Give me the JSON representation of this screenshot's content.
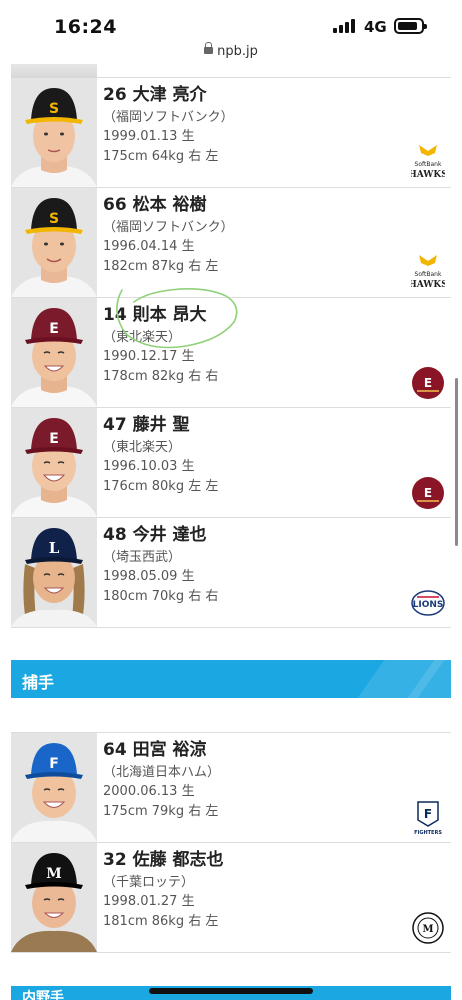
{
  "status": {
    "time": "16:24",
    "network": "4G"
  },
  "browser": {
    "url": "npb.jp"
  },
  "players_top": [
    {
      "number": "26",
      "name": "大津 亮介",
      "team": "（福岡ソフトバンク）",
      "birth": "1999.01.13 生",
      "body": "175cm 64kg 右 左",
      "team_logo": "softbank-hawks-logo"
    },
    {
      "number": "66",
      "name": "松本 裕樹",
      "team": "（福岡ソフトバンク）",
      "birth": "1996.04.14 生",
      "body": "182cm 87kg 右 左",
      "team_logo": "softbank-hawks-logo"
    },
    {
      "number": "14",
      "name": "則本 昂大",
      "team": "（東北楽天）",
      "birth": "1990.12.17 生",
      "body": "178cm 82kg 右 右",
      "team_logo": "rakuten-eagles-logo"
    },
    {
      "number": "47",
      "name": "藤井 聖",
      "team": "（東北楽天）",
      "birth": "1996.10.03 生",
      "body": "176cm 80kg 左 左",
      "team_logo": "rakuten-eagles-logo"
    },
    {
      "number": "48",
      "name": "今井 達也",
      "team": "（埼玉西武）",
      "birth": "1998.05.09 生",
      "body": "180cm 70kg 右 右",
      "team_logo": "seibu-lions-logo"
    }
  ],
  "catcher_section": {
    "label": "捕手"
  },
  "players_catcher": [
    {
      "number": "64",
      "name": "田宮 裕涼",
      "team": "（北海道日本ハム）",
      "birth": "2000.06.13 生",
      "body": "175cm 79kg 右 左",
      "team_logo": "nipponham-fighters-logo"
    },
    {
      "number": "32",
      "name": "佐藤 都志也",
      "team": "（千葉ロッテ）",
      "birth": "1998.01.27 生",
      "body": "181cm 86kg 右 左",
      "team_logo": "lotte-marines-logo"
    }
  ],
  "next_section": {
    "label": "内野手"
  },
  "colors": {
    "section_bg": "#1ba7e2",
    "hawks_cap": "#1a1a1a",
    "hawks_brim": "#f2b600",
    "eagles_cap": "#7a1a2a",
    "lions_cap": "#10224a",
    "fighters_cap": "#1a66c8",
    "marines_cap": "#111111",
    "scribble": "#8fd17a"
  }
}
